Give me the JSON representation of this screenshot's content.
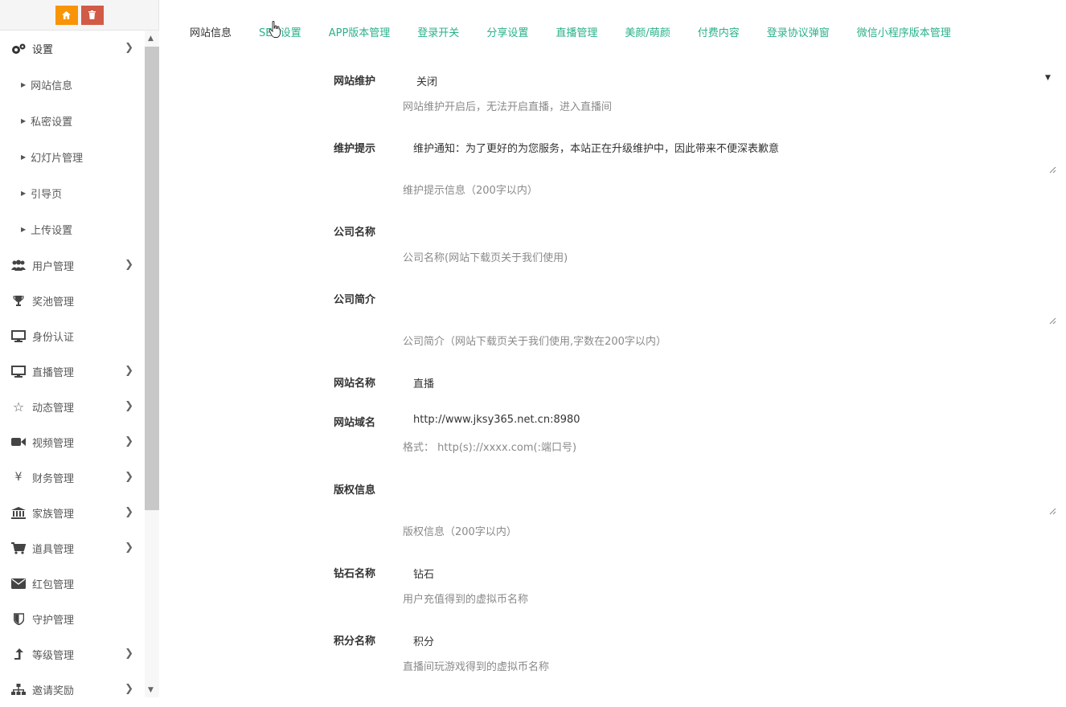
{
  "sidebar": {
    "top_buttons": [
      {
        "icon": "home-icon",
        "color": "#f89406"
      },
      {
        "icon": "trash-icon",
        "color": "#d15b47"
      }
    ],
    "settings": {
      "label": "设置",
      "sub": [
        "网站信息",
        "私密设置",
        "幻灯片管理",
        "引导页",
        "上传设置"
      ]
    },
    "items": [
      {
        "label": "用户管理",
        "icon": "users-icon",
        "chevron": true
      },
      {
        "label": "奖池管理",
        "icon": "trophy-icon",
        "chevron": false
      },
      {
        "label": "身份认证",
        "icon": "desktop-icon",
        "chevron": false
      },
      {
        "label": "直播管理",
        "icon": "desktop-icon",
        "chevron": true
      },
      {
        "label": "动态管理",
        "icon": "star-icon",
        "chevron": true
      },
      {
        "label": "视频管理",
        "icon": "video-icon",
        "chevron": true
      },
      {
        "label": "财务管理",
        "icon": "yen-icon",
        "chevron": true
      },
      {
        "label": "家族管理",
        "icon": "bank-icon",
        "chevron": true
      },
      {
        "label": "道具管理",
        "icon": "cart-icon",
        "chevron": true
      },
      {
        "label": "红包管理",
        "icon": "envelope-icon",
        "chevron": false
      },
      {
        "label": "守护管理",
        "icon": "shield-icon",
        "chevron": false
      },
      {
        "label": "等级管理",
        "icon": "level-up-icon",
        "chevron": true
      },
      {
        "label": "邀请奖励",
        "icon": "sitemap-icon",
        "chevron": true
      }
    ]
  },
  "tabs": [
    "网站信息",
    "SEO设置",
    "APP版本管理",
    "登录开关",
    "分享设置",
    "直播管理",
    "美颜/萌颜",
    "付费内容",
    "登录协议弹窗",
    "微信小程序版本管理"
  ],
  "form": {
    "maintenance": {
      "label": "网站维护",
      "value": "关闭",
      "help": "网站维护开启后，无法开启直播，进入直播间"
    },
    "notice": {
      "label": "维护提示",
      "value": "维护通知：为了更好的为您服务，本站正在升级维护中，因此带来不便深表歉意",
      "help": "维护提示信息（200字以内）"
    },
    "company": {
      "label": "公司名称",
      "value": "",
      "help": "公司名称(网站下载页关于我们使用)"
    },
    "intro": {
      "label": "公司简介",
      "value": "",
      "help": "公司简介（网站下载页关于我们使用,字数在200字以内）"
    },
    "site_name": {
      "label": "网站名称",
      "value": "直播"
    },
    "domain": {
      "label": "网站域名",
      "value": "http://www.jksy365.net.cn:8980",
      "help": "格式： http(s)://xxxx.com(:端口号)"
    },
    "copyright": {
      "label": "版权信息",
      "value": "",
      "help": "版权信息（200字以内）"
    },
    "diamond": {
      "label": "钻石名称",
      "value": "钻石",
      "help": "用户充值得到的虚拟币名称"
    },
    "points": {
      "label": "积分名称",
      "value": "积分",
      "help": "直播间玩游戏得到的虚拟币名称"
    }
  },
  "colors": {
    "accent": "#2bb18b",
    "home_btn": "#f89406",
    "delete_btn": "#d15b47"
  }
}
